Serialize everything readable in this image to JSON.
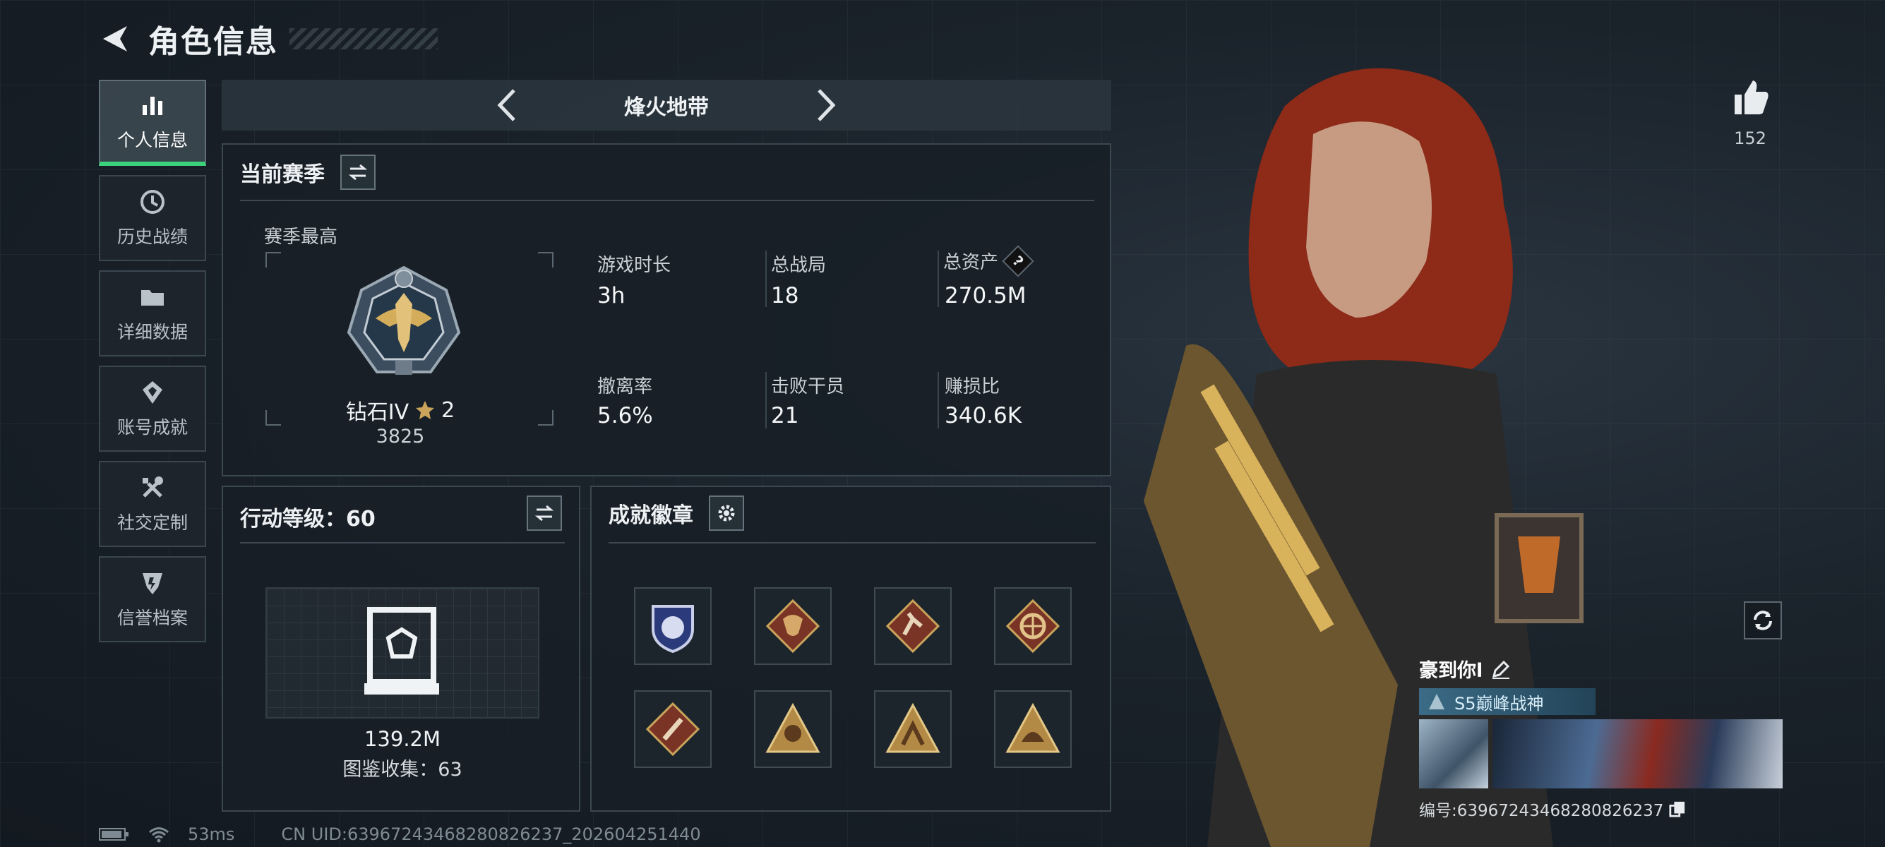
{
  "header": {
    "title": "角色信息"
  },
  "sidebar": {
    "items": [
      {
        "label": "个人信息",
        "icon": "bar-chart-icon",
        "active": true
      },
      {
        "label": "历史战绩",
        "icon": "history-icon"
      },
      {
        "label": "详细数据",
        "icon": "folder-icon"
      },
      {
        "label": "账号成就",
        "icon": "achievement-icon"
      },
      {
        "label": "社交定制",
        "icon": "tools-icon"
      },
      {
        "label": "信誉档案",
        "icon": "shield-icon"
      }
    ]
  },
  "mode_bar": {
    "title": "烽火地带"
  },
  "season": {
    "title": "当前赛季",
    "best_label": "赛季最高",
    "rank_name": "钻石IV",
    "rank_stars": "2",
    "rank_score": "3825",
    "stats": [
      {
        "label": "游戏时长",
        "value": "3h"
      },
      {
        "label": "总战局",
        "value": "18"
      },
      {
        "label": "总资产",
        "value": "270.5M",
        "help": "?"
      },
      {
        "label": "撤离率",
        "value": "5.6%"
      },
      {
        "label": "击败干员",
        "value": "21"
      },
      {
        "label": "赚损比",
        "value": "340.6K"
      }
    ]
  },
  "action_level": {
    "title": "行动等级：60",
    "collection_value": "139.2M",
    "collection_label": "图鉴收集：63"
  },
  "badges": {
    "title": "成就徽章"
  },
  "character": {
    "likes": "152",
    "name": "豪到你l",
    "title_tag": "S5巅峰战神",
    "id_text": "编号:63967243468280826237"
  },
  "footer": {
    "ping": "53ms",
    "uid": "CN UID:63967243468280826237_202604251440"
  },
  "colors": {
    "accent_green": "#3ad27a",
    "panel_border": "#3a4650",
    "badge_red": "#8a3a2a",
    "badge_gold": "#c9a45a"
  }
}
